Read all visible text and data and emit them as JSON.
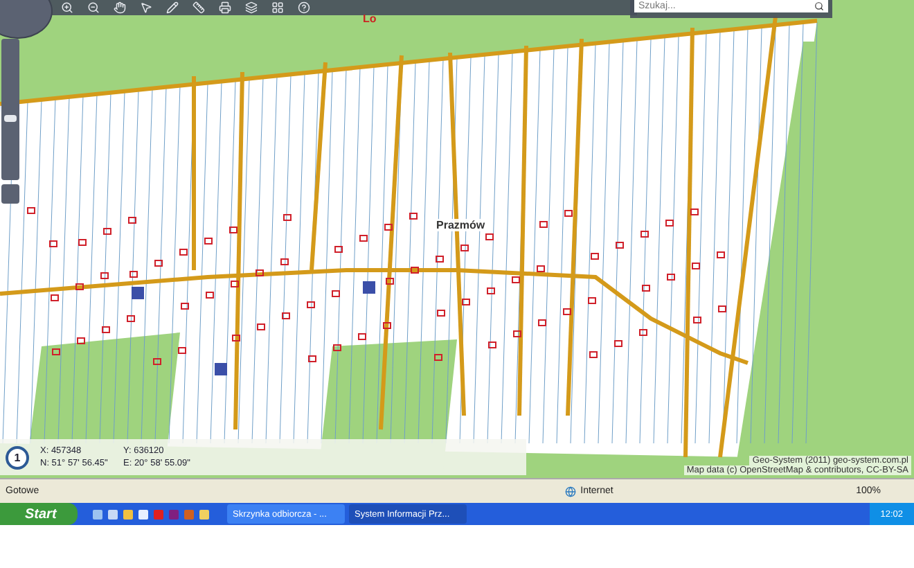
{
  "toolbar": {
    "search": {
      "placeholder": "Szukaj..."
    }
  },
  "zoom_slider": {
    "level": 0.45
  },
  "map": {
    "place_label": "Prazmów",
    "marker_label": "Lo",
    "coordinates": {
      "scale_badge": "1",
      "x": "X: 457348",
      "y": "Y: 636120",
      "n": "N: 51° 57' 56.45\"",
      "e": "E: 20° 58' 55.09\""
    },
    "attribution": [
      "Geo-System (2011) geo-system.com.pl",
      "Map data (c) OpenStreetMap & contributors, CC-BY-SA"
    ]
  },
  "status_bar": {
    "text": "Gotowe",
    "zone": "Internet",
    "zoom": "100%"
  },
  "taskbar": {
    "start": "Start",
    "windows": [
      {
        "label": "Skrzynka odbiorcza - ...",
        "selected": false
      },
      {
        "label": "System Informacji Prz...",
        "selected": true
      }
    ],
    "clock": "12:02"
  }
}
